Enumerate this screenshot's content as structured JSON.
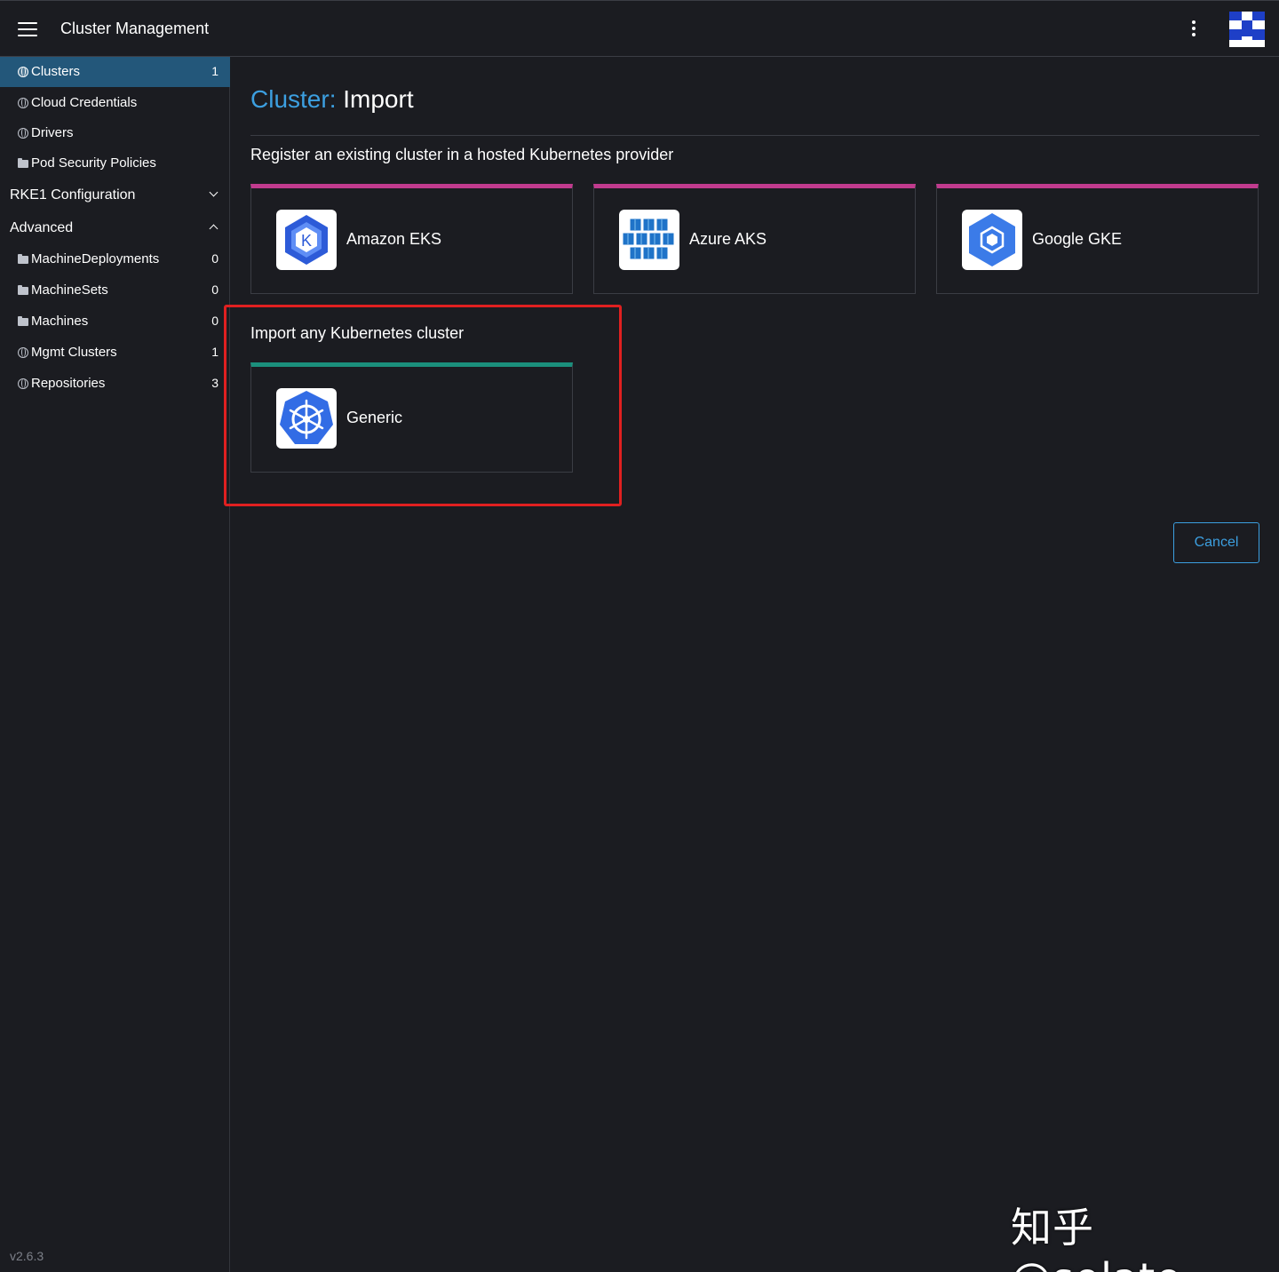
{
  "header": {
    "app_title": "Cluster Management",
    "menu_icon": "hamburger-menu-icon",
    "more_icon": "kebab-menu-icon",
    "avatar_icon": "user-avatar"
  },
  "sidebar": {
    "items": [
      {
        "label": "Clusters",
        "count": "1",
        "icon": "globe-icon",
        "active": true
      },
      {
        "label": "Cloud Credentials",
        "count": "",
        "icon": "globe-icon"
      },
      {
        "label": "Drivers",
        "count": "",
        "icon": "globe-icon"
      },
      {
        "label": "Pod Security Policies",
        "count": "",
        "icon": "folder-icon"
      }
    ],
    "groups": [
      {
        "label": "RKE1 Configuration",
        "state": "collapsed"
      },
      {
        "label": "Advanced",
        "state": "expanded"
      }
    ],
    "advanced_items": [
      {
        "label": "MachineDeployments",
        "count": "0",
        "icon": "folder-icon"
      },
      {
        "label": "MachineSets",
        "count": "0",
        "icon": "folder-icon"
      },
      {
        "label": "Machines",
        "count": "0",
        "icon": "folder-icon"
      },
      {
        "label": "Mgmt Clusters",
        "count": "1",
        "icon": "globe-icon"
      },
      {
        "label": "Repositories",
        "count": "3",
        "icon": "globe-icon"
      }
    ],
    "version": "v2.6.3"
  },
  "main": {
    "title_prefix": "Cluster:",
    "title_suffix": "Import",
    "hosted_section_title": "Register an existing cluster in a hosted Kubernetes provider",
    "hosted_providers": [
      {
        "name": "Amazon EKS",
        "icon": "amazon-eks-logo-icon"
      },
      {
        "name": "Azure AKS",
        "icon": "azure-aks-logo-icon"
      },
      {
        "name": "Google GKE",
        "icon": "google-gke-logo-icon"
      }
    ],
    "generic_section_title": "Import any Kubernetes cluster",
    "generic_provider": {
      "name": "Generic",
      "icon": "kubernetes-logo-icon"
    },
    "cancel_label": "Cancel"
  },
  "watermark": "知乎 @solate",
  "colors": {
    "background": "#1b1c21",
    "accent_blue": "#3c9fe0",
    "active_nav": "#23577a",
    "hosted_card_top": "#c13b8e",
    "generic_card_top": "#1b8f7c",
    "highlight": "#e02020"
  }
}
